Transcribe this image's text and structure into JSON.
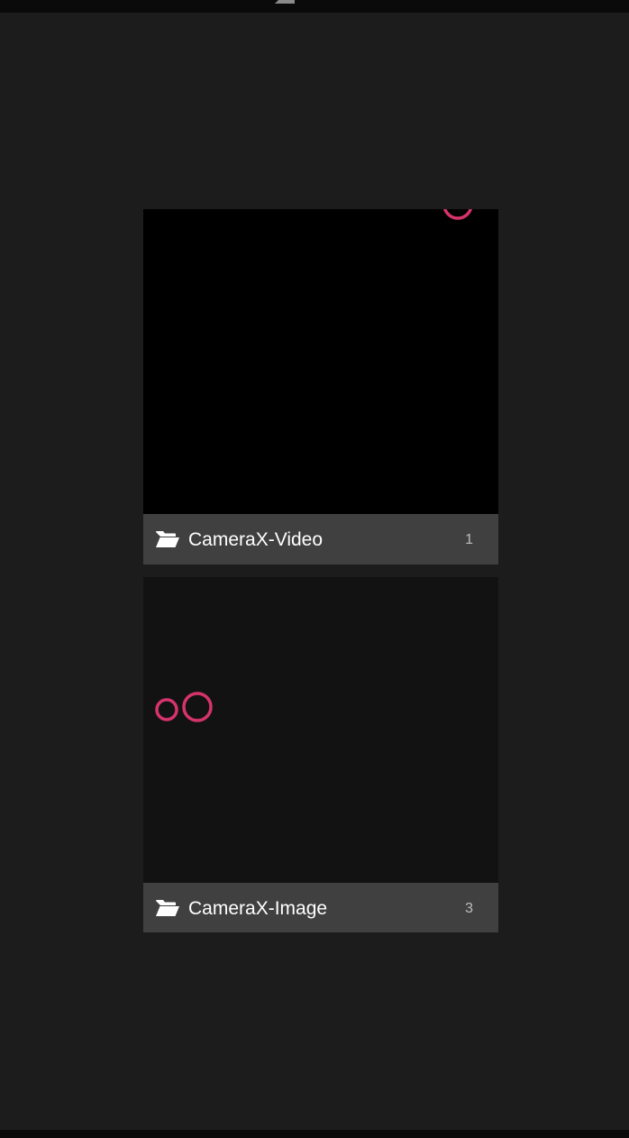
{
  "albums": [
    {
      "name": "CameraX-Video",
      "count": "1",
      "folder_icon": "folder-open-icon",
      "thumbnail_bg": "#000000"
    },
    {
      "name": "CameraX-Image",
      "count": "3",
      "folder_icon": "folder-open-icon",
      "thumbnail_bg": "#121212"
    }
  ],
  "colors": {
    "background": "#1c1c1c",
    "caption_bg": "#404040",
    "accent_ring": "#d6336c",
    "system_bar": "#0a0a0a"
  }
}
